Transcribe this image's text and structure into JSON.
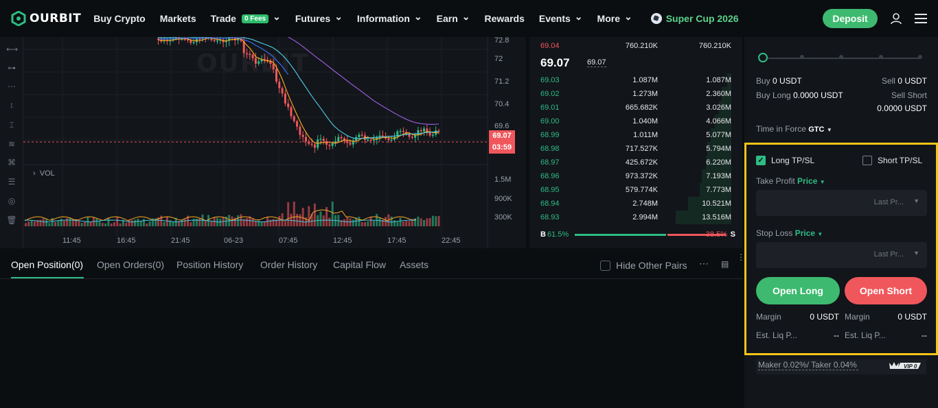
{
  "nav": {
    "logo": "OURBIT",
    "items": [
      {
        "label": "Buy Crypto",
        "has_chevron": false
      },
      {
        "label": "Markets",
        "has_chevron": false
      },
      {
        "label": "Trade",
        "badge": "0 Fees",
        "has_chevron": true
      },
      {
        "label": "Futures",
        "has_chevron": true
      },
      {
        "label": "Information",
        "has_chevron": true
      },
      {
        "label": "Earn",
        "has_chevron": true
      },
      {
        "label": "Rewards",
        "has_chevron": false
      },
      {
        "label": "Events",
        "has_chevron": true
      },
      {
        "label": "More",
        "has_chevron": true
      }
    ],
    "promo": "Super Cup 2026",
    "deposit": "Deposit"
  },
  "chart": {
    "watermark": "OURBIT",
    "y_ticks": [
      "72.8",
      "72",
      "71.2",
      "70.4",
      "69.6"
    ],
    "current_price": "69.07",
    "countdown": "03:59",
    "vol_label": "VOL",
    "vol_ticks": [
      "1.5M",
      "900K",
      "300K"
    ],
    "x_ticks": [
      "11:45",
      "16:45",
      "21:45",
      "06-23",
      "07:45",
      "12:45",
      "17:45",
      "22:45"
    ],
    "colors": {
      "up": "#2ebd85",
      "down": "#f0575c",
      "ma_orange": "#f5a623",
      "ma_cyan": "#4fc3d9",
      "ma_purple": "#9b59d9",
      "ma_blue": "#3a6df0"
    }
  },
  "orderbook": {
    "top_ask": {
      "price": "69.04",
      "qty": "760.210K",
      "total": "760.210K"
    },
    "last_price": "69.07",
    "mark_price": "69.07",
    "bids": [
      {
        "price": "69.03",
        "qty": "1.087M",
        "total": "1.087M",
        "depth": 0.08
      },
      {
        "price": "69.02",
        "qty": "1.273M",
        "total": "2.360M",
        "depth": 0.17
      },
      {
        "price": "69.01",
        "qty": "665.682K",
        "total": "3.026M",
        "depth": 0.22
      },
      {
        "price": "69.00",
        "qty": "1.040M",
        "total": "4.066M",
        "depth": 0.3
      },
      {
        "price": "68.99",
        "qty": "1.011M",
        "total": "5.077M",
        "depth": 0.37
      },
      {
        "price": "68.98",
        "qty": "717.527K",
        "total": "5.794M",
        "depth": 0.43
      },
      {
        "price": "68.97",
        "qty": "425.672K",
        "total": "6.220M",
        "depth": 0.46
      },
      {
        "price": "68.96",
        "qty": "973.372K",
        "total": "7.193M",
        "depth": 0.53
      },
      {
        "price": "68.95",
        "qty": "579.774K",
        "total": "7.773M",
        "depth": 0.57
      },
      {
        "price": "68.94",
        "qty": "2.748M",
        "total": "10.521M",
        "depth": 0.78
      },
      {
        "price": "68.93",
        "qty": "2.994M",
        "total": "13.516M",
        "depth": 1.0
      }
    ],
    "buy_ratio": "61.5%",
    "sell_ratio": "38.5%",
    "buy_letter": "B",
    "sell_letter": "S"
  },
  "bottom_tabs": {
    "tabs": [
      "Open Position(0)",
      "Open Orders(0)",
      "Position History",
      "Order History",
      "Capital Flow",
      "Assets"
    ],
    "hide_other_pairs": "Hide Other Pairs"
  },
  "order_panel": {
    "buy_label": "Buy",
    "buy_value": "0 USDT",
    "sell_label": "Sell",
    "sell_value": "0 USDT",
    "buy_long_label": "Buy Long",
    "buy_long_value": "0.0000 USDT",
    "sell_short_label": "Sell Short",
    "sell_short_value": "0.0000 USDT",
    "tif_label": "Time in Force",
    "tif_value": "GTC",
    "long_tpsl": "Long TP/SL",
    "short_tpsl": "Short TP/SL",
    "take_profit_label": "Take Profit",
    "take_profit_mode": "Price",
    "take_profit_placeholder": "Last Pr...",
    "stop_loss_label": "Stop Loss",
    "stop_loss_mode": "Price",
    "stop_loss_placeholder": "Last Pr...",
    "open_long": "Open Long",
    "open_short": "Open Short",
    "margin_label": "Margin",
    "margin_long": "0 USDT",
    "margin_short": "0 USDT",
    "liq_label": "Est. Liq P...",
    "liq_long": "--",
    "liq_short": "--",
    "fees": "Maker 0.02%/ Taker 0.04%",
    "vip": "VIP 0"
  }
}
